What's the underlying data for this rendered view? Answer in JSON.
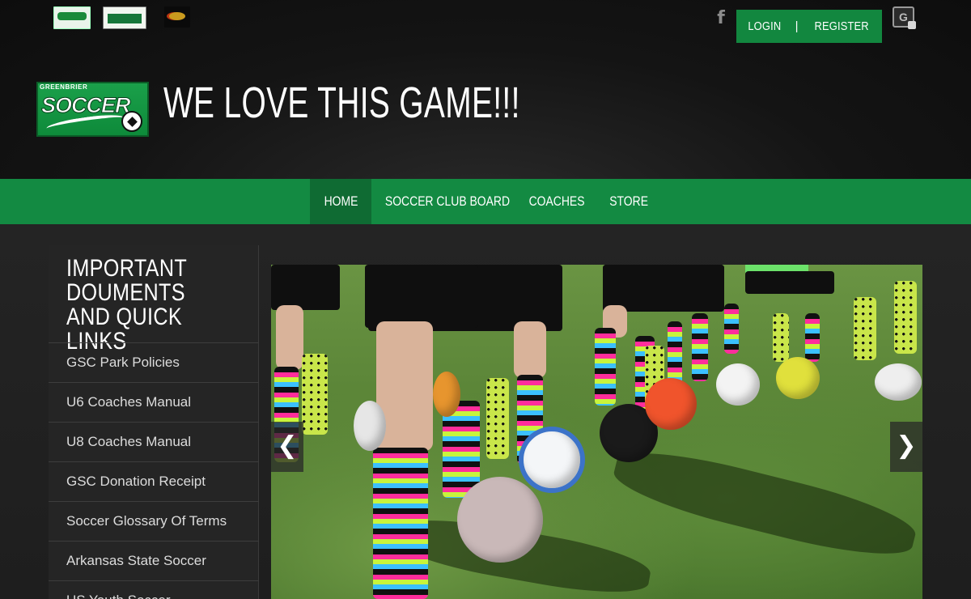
{
  "header": {
    "tagline": "WE LOVE THIS GAME!!!",
    "logo": {
      "top_text": "GREENBRIER",
      "word": "SOCCER"
    },
    "auth": {
      "login_label": "LOGIN",
      "separator": "|",
      "register_label": "REGISTER"
    },
    "facebook_glyph": "f",
    "translate_glyph": "G",
    "sponsors": [
      "soccer-logo",
      "dicks-sporting-goods-logo",
      "sponsor-logo"
    ]
  },
  "nav": {
    "items": [
      {
        "label": "HOME",
        "active": true
      },
      {
        "label": "SOCCER CLUB BOARD",
        "active": false
      },
      {
        "label": "COACHES",
        "active": false
      },
      {
        "label": "STORE",
        "active": false
      }
    ]
  },
  "sidebar": {
    "title": "IMPORTANT DOUMENTS AND QUICK LINKS",
    "links": [
      "GSC Park Policies",
      "U6 Coaches Manual",
      "U8 Coaches Manual",
      "GSC Donation Receipt",
      "Soccer Glossary Of Terms",
      "Arkansas State Soccer",
      "US Youth Soccer"
    ]
  },
  "slider": {
    "prev_glyph": "❮",
    "next_glyph": "❯"
  },
  "colors": {
    "brand_green": "#138a42",
    "nav_active": "#0f6b33",
    "header_bg": "#111111",
    "sidebar_bg": "#252525"
  }
}
